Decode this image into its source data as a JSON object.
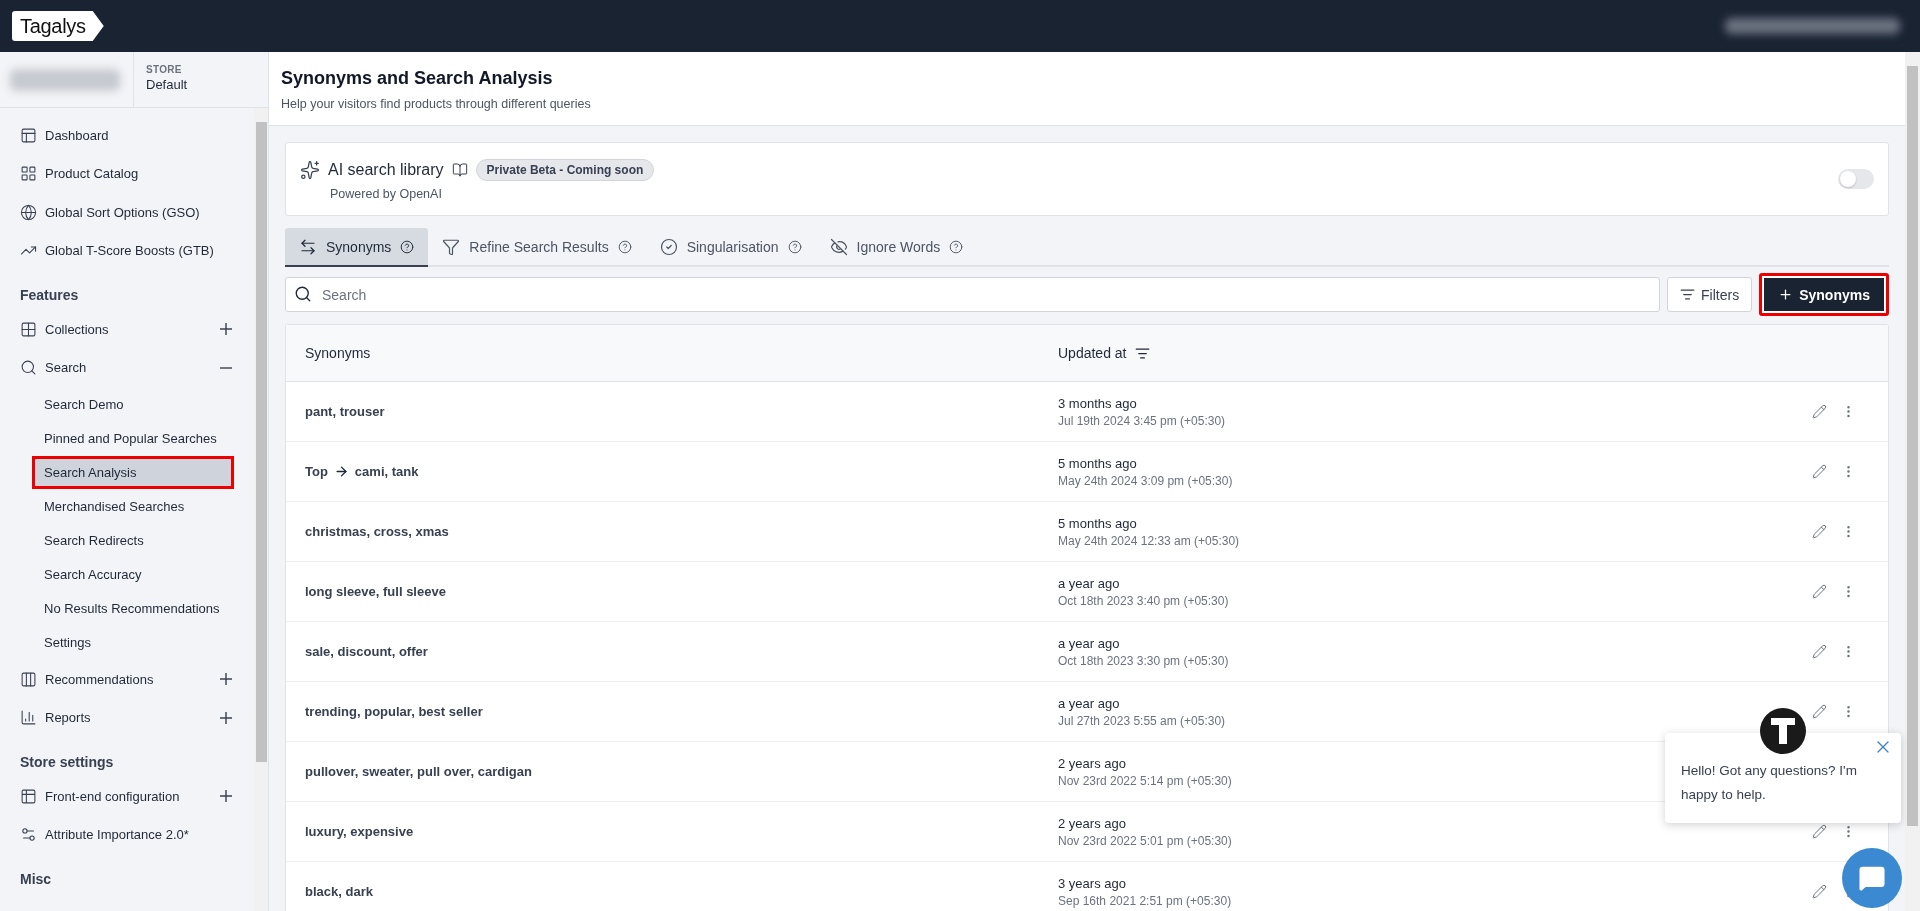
{
  "top_bar": {
    "logo": "Tagalys"
  },
  "store": {
    "label": "STORE",
    "value": "Default"
  },
  "sidebar": {
    "sections": [
      {
        "items": [
          {
            "label": "Dashboard"
          },
          {
            "label": "Product Catalog"
          },
          {
            "label": "Global Sort Options (GSO)"
          },
          {
            "label": "Global T-Score Boosts (GTB)"
          }
        ]
      },
      {
        "heading": "Features",
        "items": [
          {
            "label": "Collections",
            "expanded": false
          },
          {
            "label": "Search",
            "expanded": true,
            "children": [
              {
                "label": "Search Demo",
                "selected": false
              },
              {
                "label": "Pinned and Popular Searches",
                "selected": false
              },
              {
                "label": "Search Analysis",
                "selected": true
              },
              {
                "label": "Merchandised Searches",
                "selected": false
              },
              {
                "label": "Search Redirects",
                "selected": false
              },
              {
                "label": "Search Accuracy",
                "selected": false
              },
              {
                "label": "No Results Recommendations",
                "selected": false
              },
              {
                "label": "Settings",
                "selected": false
              }
            ]
          },
          {
            "label": "Recommendations",
            "expanded": false
          },
          {
            "label": "Reports",
            "expanded": false
          }
        ]
      },
      {
        "heading": "Store settings",
        "items": [
          {
            "label": "Front-end configuration",
            "expanded": false
          },
          {
            "label": "Attribute Importance 2.0*"
          }
        ]
      },
      {
        "heading": "Misc"
      }
    ]
  },
  "page": {
    "title": "Synonyms and Search Analysis",
    "subtitle": "Help your visitors find products through different queries"
  },
  "ai_card": {
    "title": "AI search library",
    "badge": "Private Beta - Coming soon",
    "subtitle": "Powered by OpenAI",
    "on": false
  },
  "tabs": [
    {
      "label": "Synonyms",
      "selected": true
    },
    {
      "label": "Refine Search Results",
      "selected": false
    },
    {
      "label": "Singularisation",
      "selected": false
    },
    {
      "label": "Ignore Words",
      "selected": false
    }
  ],
  "search": {
    "placeholder": "Search"
  },
  "filters_button": "Filters",
  "add_button": {
    "label": "Synonyms",
    "highlighted": true
  },
  "table": {
    "columns": [
      "Synonyms",
      "Updated at"
    ],
    "rows": [
      {
        "kind": "two_way",
        "terms": "pant, trouser",
        "updated": "3 months ago",
        "date": "Jul 19th 2024 3:45 pm (+05:30)"
      },
      {
        "kind": "one_way",
        "from": "Top",
        "to": "cami, tank",
        "updated": "5 months ago",
        "date": "May 24th 2024 3:09 pm (+05:30)"
      },
      {
        "kind": "two_way",
        "terms": "christmas, cross, xmas",
        "updated": "5 months ago",
        "date": "May 24th 2024 12:33 am (+05:30)"
      },
      {
        "kind": "two_way",
        "terms": "long sleeve, full sleeve",
        "updated": "a year ago",
        "date": "Oct 18th 2023 3:40 pm (+05:30)"
      },
      {
        "kind": "two_way",
        "terms": "sale, discount, offer",
        "updated": "a year ago",
        "date": "Oct 18th 2023 3:30 pm (+05:30)"
      },
      {
        "kind": "two_way",
        "terms": "trending, popular, best seller",
        "updated": "a year ago",
        "date": "Jul 27th 2023 5:55 am (+05:30)"
      },
      {
        "kind": "two_way",
        "terms": "pullover, sweater, pull over, cardigan",
        "updated": "2 years ago",
        "date": "Nov 23rd 2022 5:14 pm (+05:30)"
      },
      {
        "kind": "two_way",
        "terms": "luxury, expensive",
        "updated": "2 years ago",
        "date": "Nov 23rd 2022 5:01 pm (+05:30)"
      },
      {
        "kind": "two_way",
        "terms": "black, dark",
        "updated": "3 years ago",
        "date": "Sep 16th 2021 2:51 pm (+05:30)"
      }
    ]
  },
  "chat": {
    "message": "Hello! Got any questions? I'm happy to help."
  }
}
